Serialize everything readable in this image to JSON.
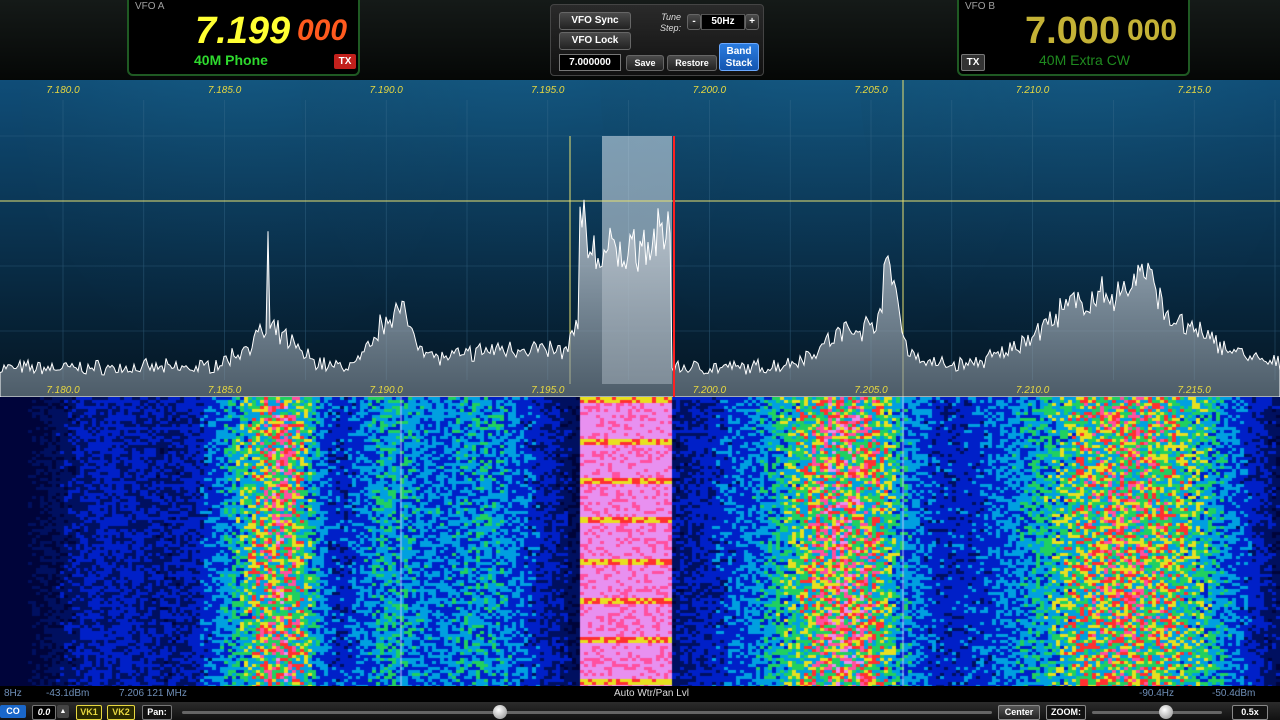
{
  "vfo_a": {
    "label": "VFO A",
    "freq_main": "7.199",
    "freq_fine": "000",
    "mode": "40M Phone",
    "tx": "TX"
  },
  "vfo_b": {
    "label": "VFO B",
    "freq_main": "7.000",
    "freq_fine": "000",
    "mode": "40M Extra CW",
    "tx": "TX"
  },
  "controls": {
    "vfo_sync": "VFO Sync",
    "vfo_lock": "VFO Lock",
    "tune_step_label": "Tune Step:",
    "tune_step_minus": "-",
    "tune_step_value": "50Hz",
    "tune_step_plus": "+",
    "memory_freq": "7.000000",
    "save": "Save",
    "restore": "Restore",
    "band_stack": "Band Stack"
  },
  "spectrum": {
    "freq_ticks": [
      "7.180.0",
      "7.185.0",
      "7.190.0",
      "7.195.0",
      "7.200.0",
      "7.205.0",
      "7.210.0",
      "7.215.0"
    ]
  },
  "status": {
    "left_hz": "8Hz",
    "dbm": "-43.1dBm",
    "cursor_freq": "7.206 121 MHz",
    "center_label": "Auto Wtr/Pan Lvl",
    "right_hz": "-90.4Hz",
    "right_dbm": "-50.4dBm"
  },
  "bottom": {
    "co": "CO",
    "zero": "0.0",
    "vk1": "VK1",
    "vk2": "VK2",
    "pan": "Pan:",
    "center": "Center",
    "zoom": "ZOOM:",
    "zoom_value": "0.5x"
  },
  "colors": {
    "vfo_a_freq": "#ffff33",
    "vfo_a_fine": "#ff5a1e",
    "vfo_b_freq": "#c4b236",
    "green": "#2ed92e",
    "accent_blue": "#1a67c9"
  }
}
